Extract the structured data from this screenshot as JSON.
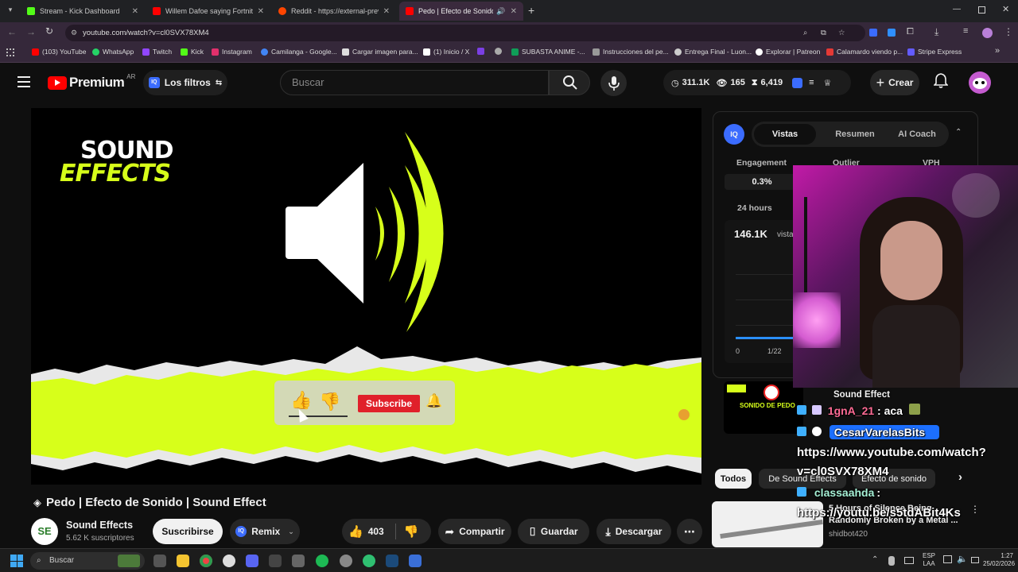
{
  "tabs": [
    {
      "label": "Stream - Kick Dashboard",
      "color": "#53fc18"
    },
    {
      "label": "Willem Dafoe saying Fortnite (l",
      "color": "#ff0000"
    },
    {
      "label": "Reddit - https://external-previ",
      "color": "#ff4500"
    },
    {
      "label": "Pedo | Efecto de Sonido",
      "color": "#ff0000"
    }
  ],
  "browser": {
    "url": "youtube.com/watch?v=cl0SVX78XM4"
  },
  "bookmarks": [
    {
      "label": "(103) YouTube",
      "color": "#ff0000"
    },
    {
      "label": "WhatsApp",
      "color": "#25d366"
    },
    {
      "label": "Twitch",
      "color": "#9146ff"
    },
    {
      "label": "Kick",
      "color": "#53fc18"
    },
    {
      "label": "Instagram",
      "color": "#e1306c"
    },
    {
      "label": "Camilanga - Google...",
      "color": "#4285f4"
    },
    {
      "label": "Cargar imagen para...",
      "color": "#dddddd"
    },
    {
      "label": "(1) Inicio / X",
      "color": "#ffffff"
    },
    {
      "label": "",
      "color": "#7b3fe4"
    },
    {
      "label": "",
      "color": "#aaaaaa"
    },
    {
      "label": "SUBASTA ANIME -...",
      "color": "#0f9d58"
    },
    {
      "label": "Instrucciones del pe...",
      "color": "#999999"
    },
    {
      "label": "Entrega Final - Luon...",
      "color": "#cccccc"
    },
    {
      "label": "Explorar | Patreon",
      "color": "#ffffff"
    },
    {
      "label": "Calamardo viendo p...",
      "color": "#e53935"
    },
    {
      "label": "Stripe Express",
      "color": "#635bff"
    }
  ],
  "youtube": {
    "logo": "Premium",
    "region": "AR",
    "filters_label": "Los filtros",
    "search_placeholder": "Buscar",
    "stats": {
      "views": "311.1K",
      "eye": "165",
      "subs": "6,419"
    },
    "create_label": "Crear"
  },
  "video": {
    "brand_line1": "SOUND",
    "brand_line2": "EFFECTS",
    "subscribe_overlay": "Subscribe",
    "title": "Pedo | Efecto de Sonido | Sound Effect",
    "channel": "Sound Effects",
    "channel_initials": "SE",
    "subscribers": "5.62 K suscriptores",
    "subscribe_button": "Suscribirse",
    "remix": "Remix",
    "likes": "403",
    "share": "Compartir",
    "save": "Guardar",
    "download": "Descargar"
  },
  "vidiq": {
    "tabs": [
      "Vistas",
      "Resumen",
      "AI Coach"
    ],
    "metrics": [
      "Engagement",
      "Outlier",
      "VPH"
    ],
    "engagement_value": "0.3%",
    "period": "24 hours",
    "views_value": "146.1K",
    "views_unit": "vista",
    "axis_zero": "0",
    "axis_date": "1/22"
  },
  "related": {
    "chips": [
      "Todos",
      "De Sound Effects",
      "Efecto de sonido"
    ],
    "card1_title": "Sound Effect",
    "card1_thumb": "SONIDO DE PEDO",
    "card2_title_1": "5 Hours of Silence Being",
    "card2_title_2": "Randomly Broken by a Metal ...",
    "card2_channel": "shidbot420"
  },
  "chat": {
    "msg1_user": "1gnA_21",
    "msg1_text": ": aca",
    "msg2_user": "CesarVarelasBits",
    "msg2_text_1": "https://www.youtube.com/watch?",
    "msg2_text_2": "v=cl0SVX78XM4",
    "msg3_user": "classaahda",
    "msg3_text": "https://youtu.be/s5tdABit4Ks"
  },
  "taskbar": {
    "search": "Buscar",
    "lang_1": "ESP",
    "lang_2": "LAA",
    "time": "1:27",
    "date": "25/02/2026"
  },
  "colors": {
    "accent": "#d7ff1a",
    "youtube_red": "#ff0000",
    "vidiq_blue": "#3b6cff"
  }
}
